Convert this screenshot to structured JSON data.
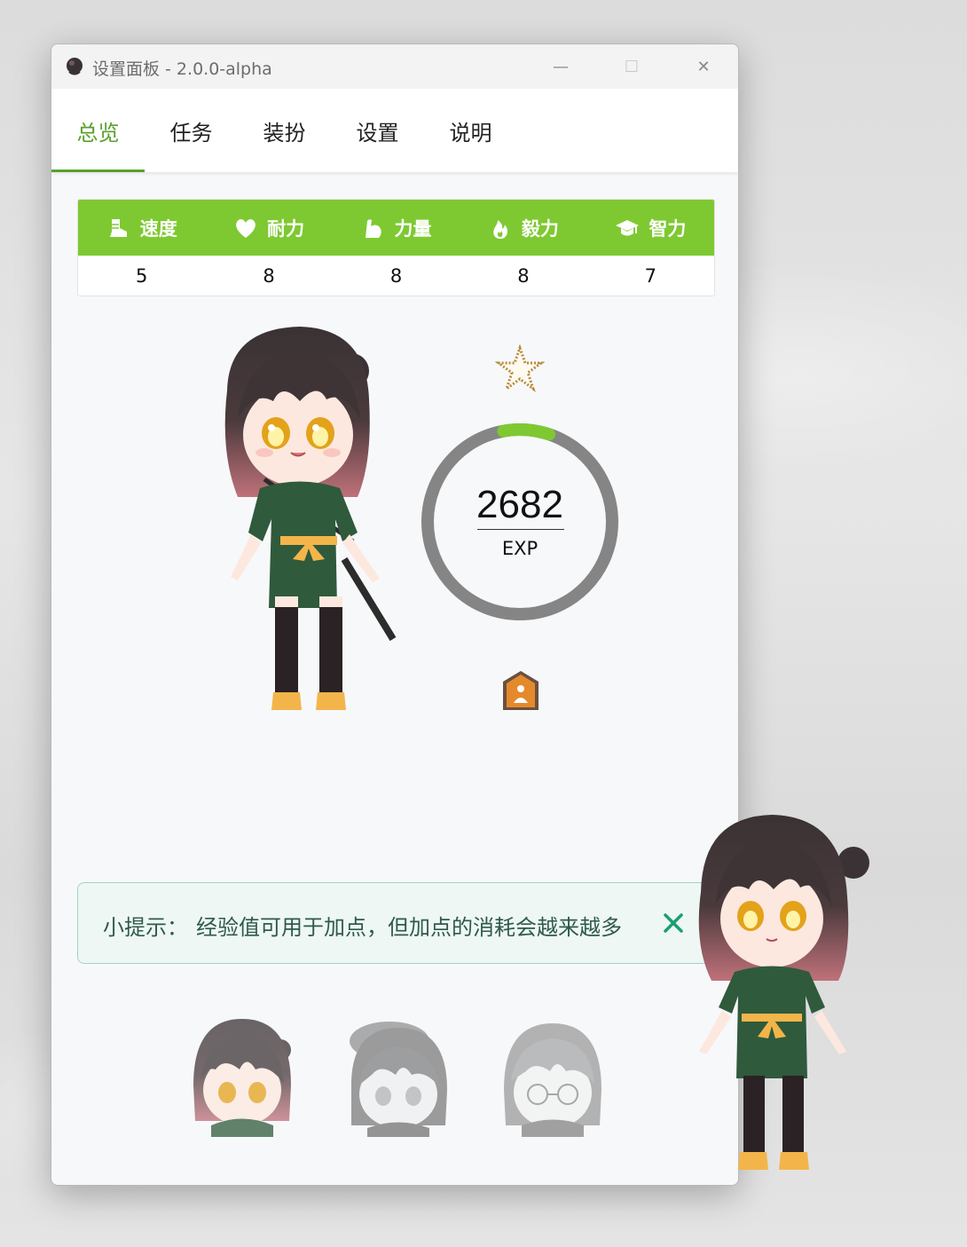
{
  "window": {
    "title": "设置面板 - 2.0.0-alpha",
    "controls": {
      "minimize": "—",
      "maximize": "☐",
      "close": "✕"
    }
  },
  "tabs": [
    {
      "label": "总览",
      "active": true
    },
    {
      "label": "任务",
      "active": false
    },
    {
      "label": "装扮",
      "active": false
    },
    {
      "label": "设置",
      "active": false
    },
    {
      "label": "说明",
      "active": false
    }
  ],
  "stats": {
    "columns": [
      {
        "icon": "boot-icon",
        "label": "速度",
        "value": "5"
      },
      {
        "icon": "heart-icon",
        "label": "耐力",
        "value": "8"
      },
      {
        "icon": "muscle-arm-icon",
        "label": "力量",
        "value": "8"
      },
      {
        "icon": "flame-icon",
        "label": "毅力",
        "value": "8"
      },
      {
        "icon": "graduation-cap-icon",
        "label": "智力",
        "value": "7"
      }
    ]
  },
  "experience": {
    "value": "2682",
    "unit": "EXP",
    "progress_fraction": 0.08,
    "ring_track_color": "#858585",
    "ring_fill_color": "#7ec931"
  },
  "level_badge_icon": "star-icon",
  "rank_badge_icon": "rank-badge-icon",
  "tip": {
    "label": "小提示：",
    "text": "经验值可用于加点，但加点的消耗会越来越多",
    "close_icon": "close-icon"
  },
  "characters": {
    "main": "chibi-girl-character",
    "floating": "chibi-girl-desktop-pet",
    "avatars": [
      "avatar-default",
      "avatar-beret",
      "avatar-glasses"
    ]
  },
  "colors": {
    "accent": "#5aa02c",
    "stats_header": "#7ec931",
    "tip_text": "#2f5a4b",
    "tip_close": "#1a9e76"
  }
}
